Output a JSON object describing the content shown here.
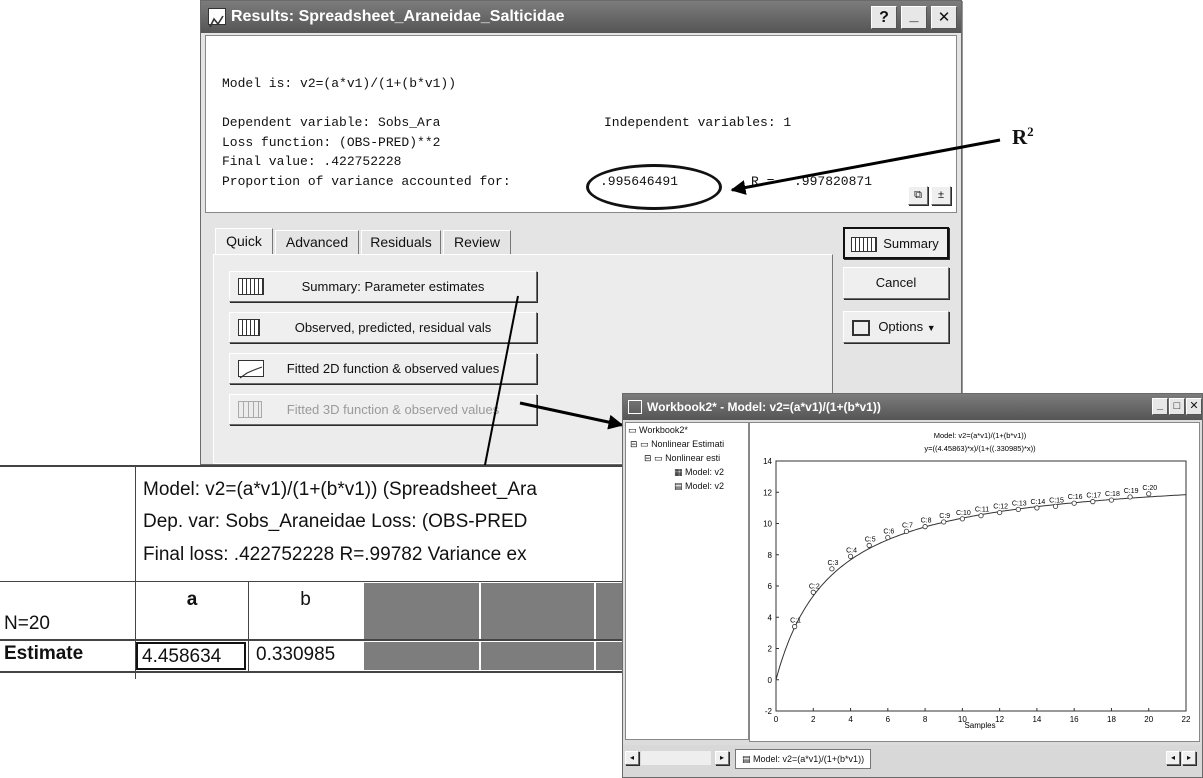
{
  "results_window": {
    "title": "Results: Spreadsheet_Araneidae_Salticidae",
    "help_btn": "?",
    "min_btn": "_",
    "close_btn": "✕",
    "model_line": "Model is: v2=(a*v1)/(1+(b*v1))",
    "dep_var": "Dependent variable: Sobs_Ara",
    "indep_var": "Independent variables:  1",
    "loss": "Loss function: (OBS-PRED)**2",
    "final_value": "Final value:   .422752228",
    "proportion_label": "Proportion of variance accounted for:",
    "proportion_value": ".995646491",
    "r_label": "R =",
    "r_value": ".997820871",
    "tabs": [
      "Quick",
      "Advanced",
      "Residuals",
      "Review"
    ],
    "buttons": {
      "summary_params": "Summary: Parameter estimates",
      "observed": "Observed, predicted, residual vals",
      "fitted2d": "Fitted 2D function & observed values",
      "fitted3d": "Fitted 3D function & observed values",
      "summary": "Summary",
      "cancel": "Cancel",
      "options": "Options"
    }
  },
  "annotation": {
    "r2": "R",
    "r2_sup": "2"
  },
  "spreadsheet": {
    "header_line1": "Model: v2=(a*v1)/(1+(b*v1)) (Spreadsheet_Ara",
    "header_line2": "Dep. var: Sobs_Araneidae Loss: (OBS-PRED",
    "header_line3": "Final loss: .422752228 R=.99782 Variance ex",
    "n_label": "N=20",
    "col_a": "a",
    "col_b": "b",
    "row_label": "Estimate",
    "a_value": "4.458634",
    "b_value": "0.330985"
  },
  "workbook": {
    "title": "Workbook2* - Model: v2=(a*v1)/(1+(b*v1))",
    "tree": [
      "Workbook2*",
      "Nonlinear Estimati",
      "Nonlinear esti",
      "Model: v2",
      "Model: v2"
    ],
    "bottom_tab": "Model: v2=(a*v1)/(1+(b*v1))",
    "min_btn": "_",
    "max_btn": "□",
    "close_btn": "✕"
  },
  "chart_data": {
    "type": "scatter",
    "title": "Model: v2=(a*v1)/(1+(b*v1))",
    "subtitle": "y=((4.45863)*x)/(1+((.330985)*x))",
    "xlabel": "Samples",
    "ylabel": "",
    "xlim": [
      0,
      22
    ],
    "ylim": [
      -2,
      14
    ],
    "x_ticks": [
      0,
      2,
      4,
      6,
      8,
      10,
      12,
      14,
      16,
      18,
      20,
      22
    ],
    "y_ticks": [
      -2,
      0,
      2,
      4,
      6,
      8,
      10,
      12,
      14
    ],
    "fit": {
      "a": 4.458634,
      "b": 0.330985
    },
    "points": [
      {
        "label": "C:1",
        "x": 1,
        "y": 3.4
      },
      {
        "label": "C:2",
        "x": 2,
        "y": 5.6
      },
      {
        "label": "C:3",
        "x": 3,
        "y": 7.1
      },
      {
        "label": "C:4",
        "x": 4,
        "y": 7.9
      },
      {
        "label": "C:5",
        "x": 5,
        "y": 8.6
      },
      {
        "label": "C:6",
        "x": 6,
        "y": 9.1
      },
      {
        "label": "C:7",
        "x": 7,
        "y": 9.5
      },
      {
        "label": "C:8",
        "x": 8,
        "y": 9.8
      },
      {
        "label": "C:9",
        "x": 9,
        "y": 10.1
      },
      {
        "label": "C:10",
        "x": 10,
        "y": 10.3
      },
      {
        "label": "C:11",
        "x": 11,
        "y": 10.5
      },
      {
        "label": "C:12",
        "x": 12,
        "y": 10.7
      },
      {
        "label": "C:13",
        "x": 13,
        "y": 10.9
      },
      {
        "label": "C:14",
        "x": 14,
        "y": 11.0
      },
      {
        "label": "C:15",
        "x": 15,
        "y": 11.1
      },
      {
        "label": "C:16",
        "x": 16,
        "y": 11.3
      },
      {
        "label": "C:17",
        "x": 17,
        "y": 11.4
      },
      {
        "label": "C:18",
        "x": 18,
        "y": 11.5
      },
      {
        "label": "C:19",
        "x": 19,
        "y": 11.7
      },
      {
        "label": "C:20",
        "x": 20,
        "y": 11.9
      }
    ]
  }
}
